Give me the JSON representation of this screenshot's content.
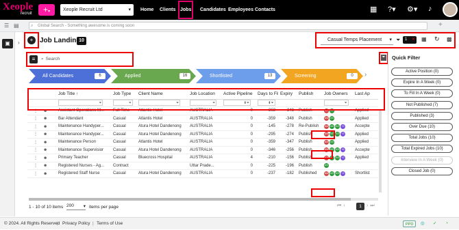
{
  "app": {
    "logo_text": "Xeople",
    "logo_sub": "recruit",
    "company": "Xeople Recruit Ltd"
  },
  "nav": [
    "Home",
    "Clients",
    "Jobs",
    "Candidates",
    "Employees",
    "Contacts"
  ],
  "search": {
    "placeholder": "Global Search - Something awesome is coming soon"
  },
  "page": {
    "title": "Job Landing",
    "count": "10",
    "placement_select": "Casual Temps Placement",
    "filter_count": "1",
    "search_placeholder": "Search"
  },
  "pipeline": [
    {
      "label": "All Candidates",
      "count": "6"
    },
    {
      "label": "Applied",
      "count": "16"
    },
    {
      "label": "Shortlisted",
      "count": "13"
    },
    {
      "label": "Screening",
      "count": "0"
    }
  ],
  "columns": [
    "Job Title ↑",
    "Job Type",
    "Client Name",
    "Job Location",
    "Active Pipeline",
    "Days to Fill",
    "Expiry",
    "Publish",
    "Job Owners",
    "Last Ap"
  ],
  "rows": [
    {
      "title": "Assistant Operations M...",
      "type": "Full Time",
      "client": "Atlantis Hotel",
      "loc": "AUSTRALIA",
      "pipe": "0",
      "days": "-363",
      "exp": "-348",
      "pub": "Publish",
      "owners": [
        "AM",
        "AS"
      ],
      "last": "Applied"
    },
    {
      "title": "Bar Attendant",
      "type": "Casual",
      "client": "Atlantis Hotel",
      "loc": "AUSTRALIA",
      "pipe": "0",
      "days": "-359",
      "exp": "-348",
      "pub": "Publish",
      "owners": [
        "AM",
        "AS"
      ],
      "last": "Applied"
    },
    {
      "title": "Maintenance Handyper...",
      "type": "Casual",
      "client": "Atura Hotel Dandenong",
      "loc": "AUSTRALIA",
      "pipe": "0",
      "days": "-145",
      "exp": "-278",
      "pub": "Re-Publish",
      "owners": [
        "AM",
        "AS",
        "AS",
        "+2"
      ],
      "last": "Accepte"
    },
    {
      "title": "Maintenance Handyper...",
      "type": "Casual",
      "client": "Atura Hotel Dandenong",
      "loc": "AUSTRALIA",
      "pipe": "0",
      "days": "-295",
      "exp": "-274",
      "pub": "Publish",
      "owners": [
        "AM",
        "AS",
        "AS",
        "+2"
      ],
      "last": "Applied"
    },
    {
      "title": "Maintenance Person",
      "type": "Casual",
      "client": "Atlantis Hotel",
      "loc": "AUSTRALIA",
      "pipe": "0",
      "days": "-359",
      "exp": "-347",
      "pub": "Publish",
      "owners": [
        "AM",
        "AS"
      ],
      "last": "Applied"
    },
    {
      "title": "Maintenance Supervisior",
      "type": "Casual",
      "client": "Atura Hotel Dandenong",
      "loc": "AUSTRALIA",
      "pipe": "0",
      "days": "-346",
      "exp": "-256",
      "pub": "Publish",
      "owners": [
        "AM",
        "AS",
        "AS",
        "+6"
      ],
      "last": "Accepte"
    },
    {
      "title": "Primary Teacher",
      "type": "Casual",
      "client": "Bluecross Hospital",
      "loc": "AUSTRALIA",
      "pipe": "4",
      "days": "-210",
      "exp": "-156",
      "pub": "Publish",
      "owners": [
        "AM",
        "AS",
        "AS",
        "+2"
      ],
      "last": "Applied"
    },
    {
      "title": "Registered Nurses - Ag...",
      "type": "Contract",
      "client": "",
      "loc": "Uttar Prade...",
      "pipe": "0",
      "days": "-225",
      "exp": "-196",
      "pub": "Publish",
      "owners": [
        "AS"
      ],
      "last": ""
    },
    {
      "title": "Registered Staff Nurse",
      "type": "Casual",
      "client": "Atura Hotel Dandenong",
      "loc": "AUSTRALIA",
      "pipe": "0",
      "days": "-237",
      "exp": "-182",
      "pub": "Published",
      "owners": [
        "AM",
        "AS",
        "AS",
        "+2"
      ],
      "last": "Shortlist"
    }
  ],
  "pagination": {
    "range": "1 - 10 of 10 items",
    "per_page": "200",
    "per_page_label": "items per page",
    "current": "1"
  },
  "quick_filter": {
    "title": "Quick Filter",
    "items": [
      {
        "label": "Active Position (0)",
        "disabled": false
      },
      {
        "label": "Expire In A Week (0)",
        "disabled": false
      },
      {
        "label": "To Fill In A Week (0)",
        "disabled": false
      },
      {
        "label": "Not Published (7)",
        "disabled": false
      },
      {
        "label": "Published (3)",
        "disabled": false
      },
      {
        "label": "Over Due (10)",
        "disabled": false
      },
      {
        "label": "Total Jobs (10)",
        "disabled": false
      },
      {
        "label": "Total Expired Jobs (10)",
        "disabled": false
      },
      {
        "label": "Interview In A Week (0)",
        "disabled": true
      },
      {
        "label": "Closed Job (0)",
        "disabled": false
      }
    ]
  },
  "footer": {
    "copyright": "© 2024. All Rights Reserved",
    "privacy": "Privacy Policy",
    "terms": "Terms of Use",
    "badge": "PPD"
  },
  "colors": {
    "brand": "#e0006d",
    "stage1": "#4d6fd8",
    "stage2": "#6aa84f",
    "stage3": "#6d9eeb",
    "stage4": "#f1a521"
  }
}
